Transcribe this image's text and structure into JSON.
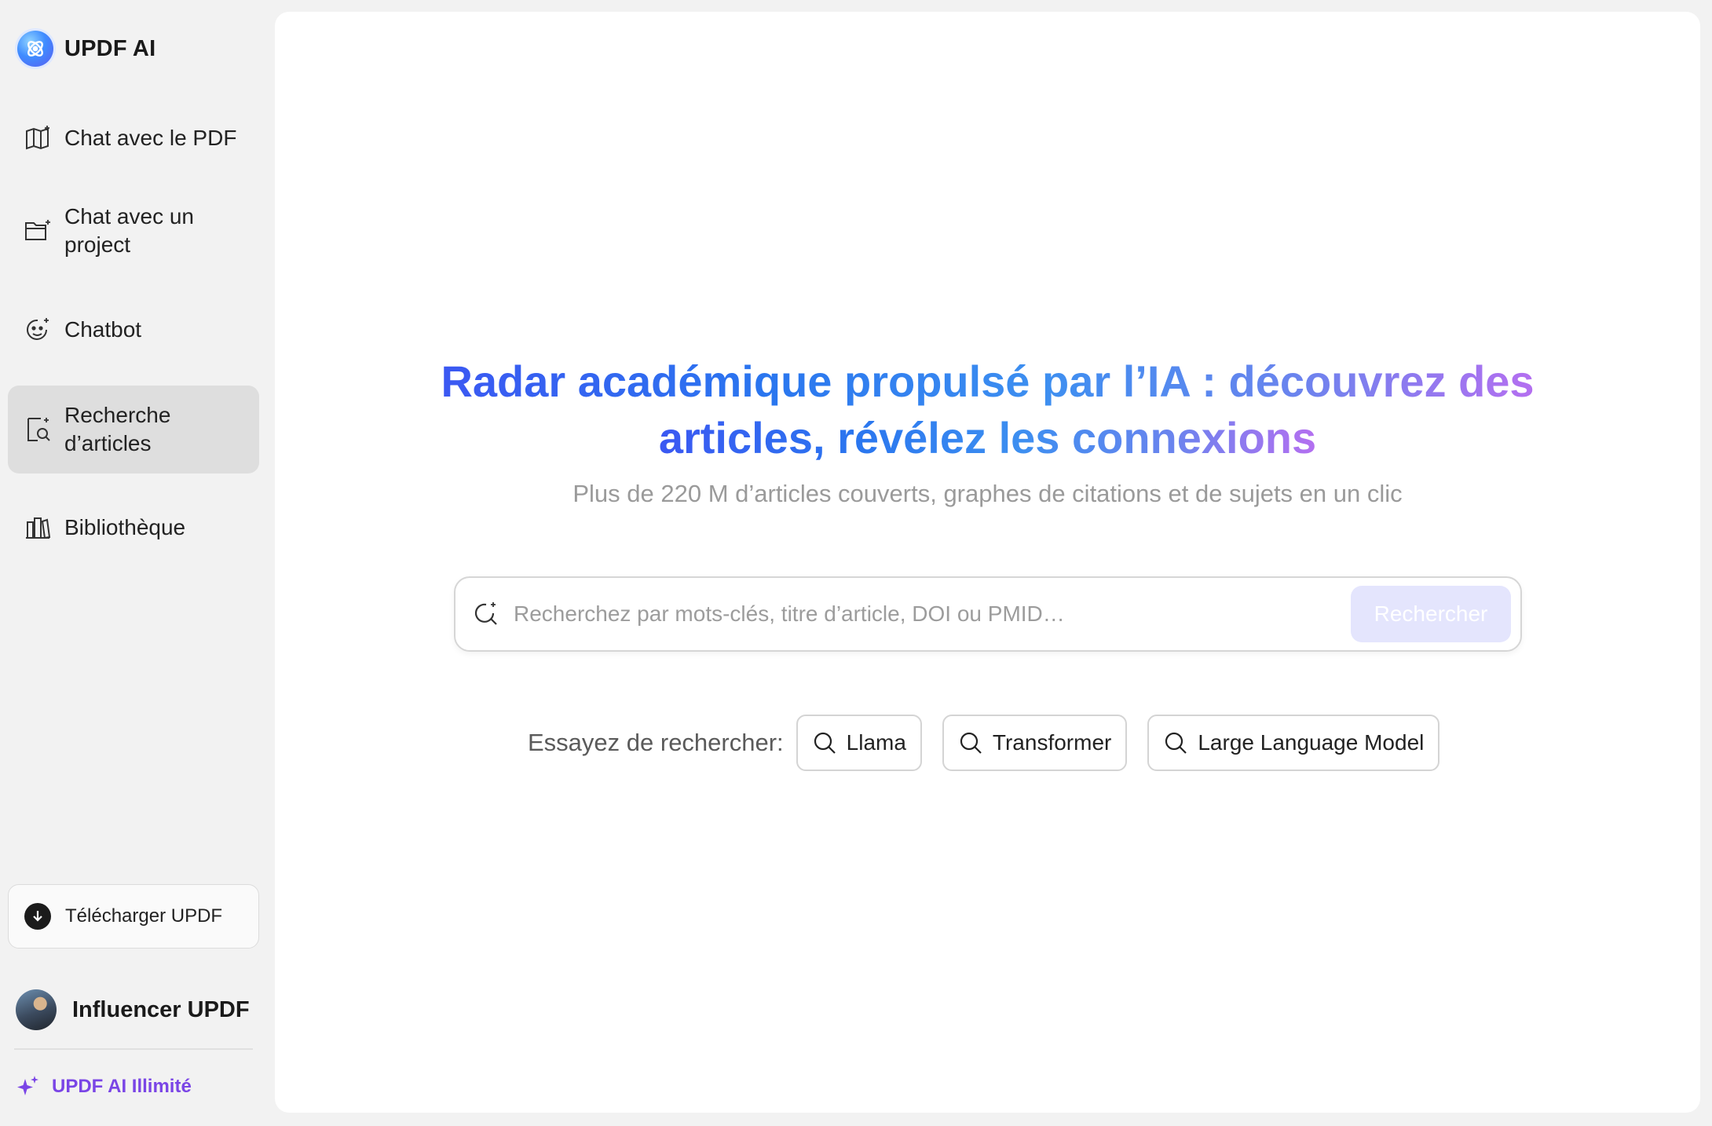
{
  "app": {
    "title": "UPDF AI"
  },
  "sidebar": {
    "items": [
      {
        "label": "Chat avec le PDF",
        "icon": "book-sparkle-icon"
      },
      {
        "label": "Chat avec un project",
        "icon": "folder-sparkle-icon"
      },
      {
        "label": "Chatbot",
        "icon": "bot-face-icon"
      },
      {
        "label": "Recherche d’articles",
        "icon": "document-search-icon",
        "active": true
      },
      {
        "label": "Bibliothèque",
        "icon": "library-icon"
      }
    ],
    "download_label": "Télécharger UPDF",
    "user_name": "Influencer UPDF",
    "upgrade_label": "UPDF AI Illimité"
  },
  "main": {
    "headline_line1": "Radar académique propulsé par l’IA : découvrez des",
    "headline_line2": "articles, révélez les connexions",
    "subtitle": "Plus de 220 M d’articles couverts, graphes de citations et de sujets en un clic",
    "search": {
      "placeholder": "Recherchez par mots-clés, titre d’article, DOI ou PMID…",
      "value": "",
      "button_label": "Rechercher"
    },
    "try_label": "Essayez de rechercher:",
    "suggestions": [
      "Llama",
      "Transformer",
      "Large Language Model"
    ]
  },
  "colors": {
    "accent_purple": "#7a45e6",
    "gradient_start": "#3b58f2",
    "gradient_end": "#b46ff0",
    "search_button_bg": "#e4e5fd",
    "active_nav_bg": "#dedede"
  }
}
